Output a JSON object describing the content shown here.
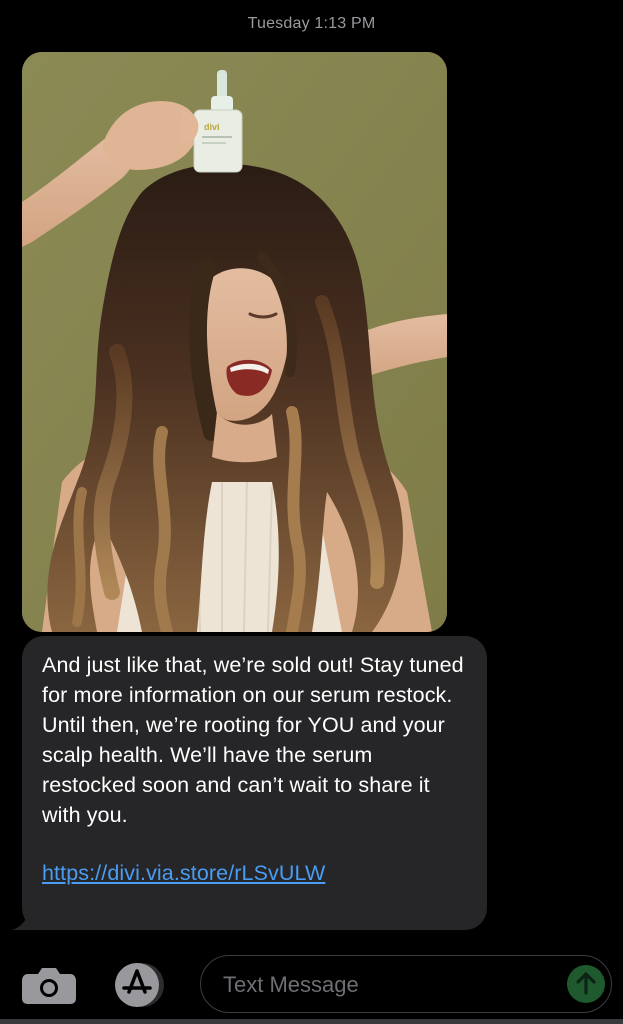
{
  "header": {
    "timestamp": "Tuesday 1:13 PM"
  },
  "message": {
    "image": {
      "bottle_brand": "divi"
    },
    "text": "And just like that, we’re sold out! Stay tuned for more information on our serum restock. Until then, we’re rooting for YOU and your scalp health. We’ll have the serum restocked soon and can’t wait to share it with you.",
    "link": "https://divi.via.store/rLSvULW"
  },
  "toolbar": {
    "input_placeholder": "Text Message",
    "camera_icon": "camera-icon",
    "apps_icon": "app-store-icon",
    "send_icon": "arrow-up-icon"
  },
  "colors": {
    "background": "#000000",
    "bubble": "#262628",
    "link": "#4a9cf2",
    "send": "#1f5a2e",
    "photo_backdrop": "#8d8a55"
  }
}
